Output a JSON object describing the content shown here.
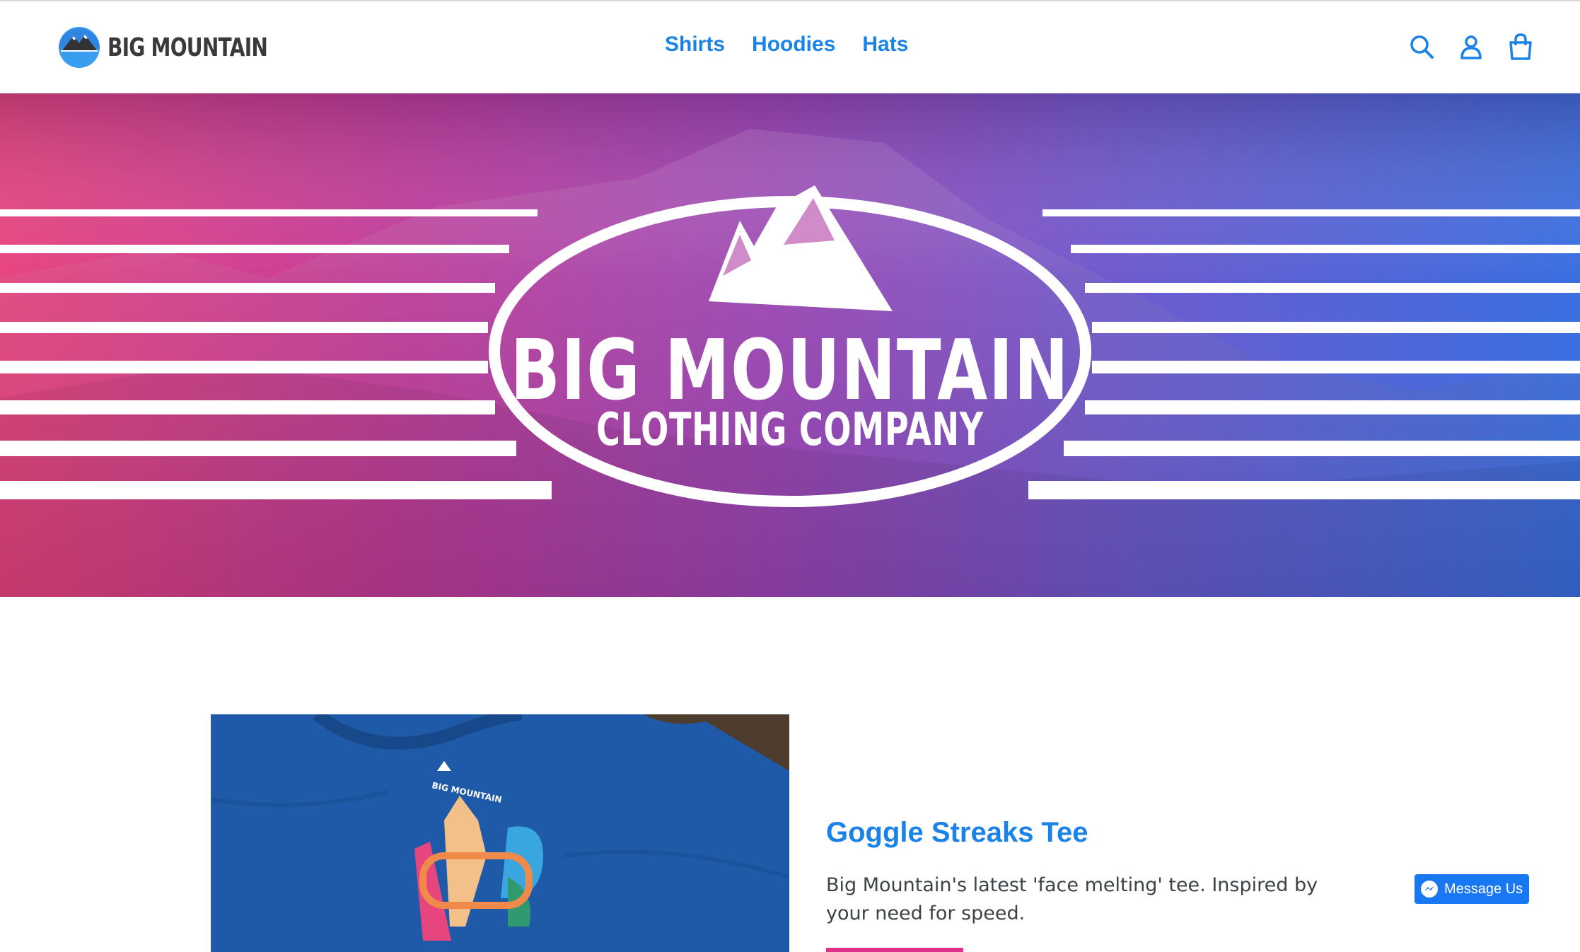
{
  "header": {
    "brand_name": "BIG MOUNTAIN",
    "nav": [
      {
        "label": "Shirts"
      },
      {
        "label": "Hoodies"
      },
      {
        "label": "Hats"
      }
    ],
    "icons": [
      "search-icon",
      "account-icon",
      "cart-icon"
    ]
  },
  "hero": {
    "title": "BIG MOUNTAIN",
    "subtitle": "CLOTHING COMPANY"
  },
  "featured_product": {
    "title": "Goggle Streaks Tee",
    "description": "Big Mountain's latest 'face melting' tee. Inspired by your need for speed.",
    "shirt_print": "BIG MOUNTAIN"
  },
  "messenger": {
    "label": "Message Us"
  },
  "colors": {
    "accent": "#1b83e8",
    "cta": "#e0318a",
    "messenger": "#1877f2"
  }
}
